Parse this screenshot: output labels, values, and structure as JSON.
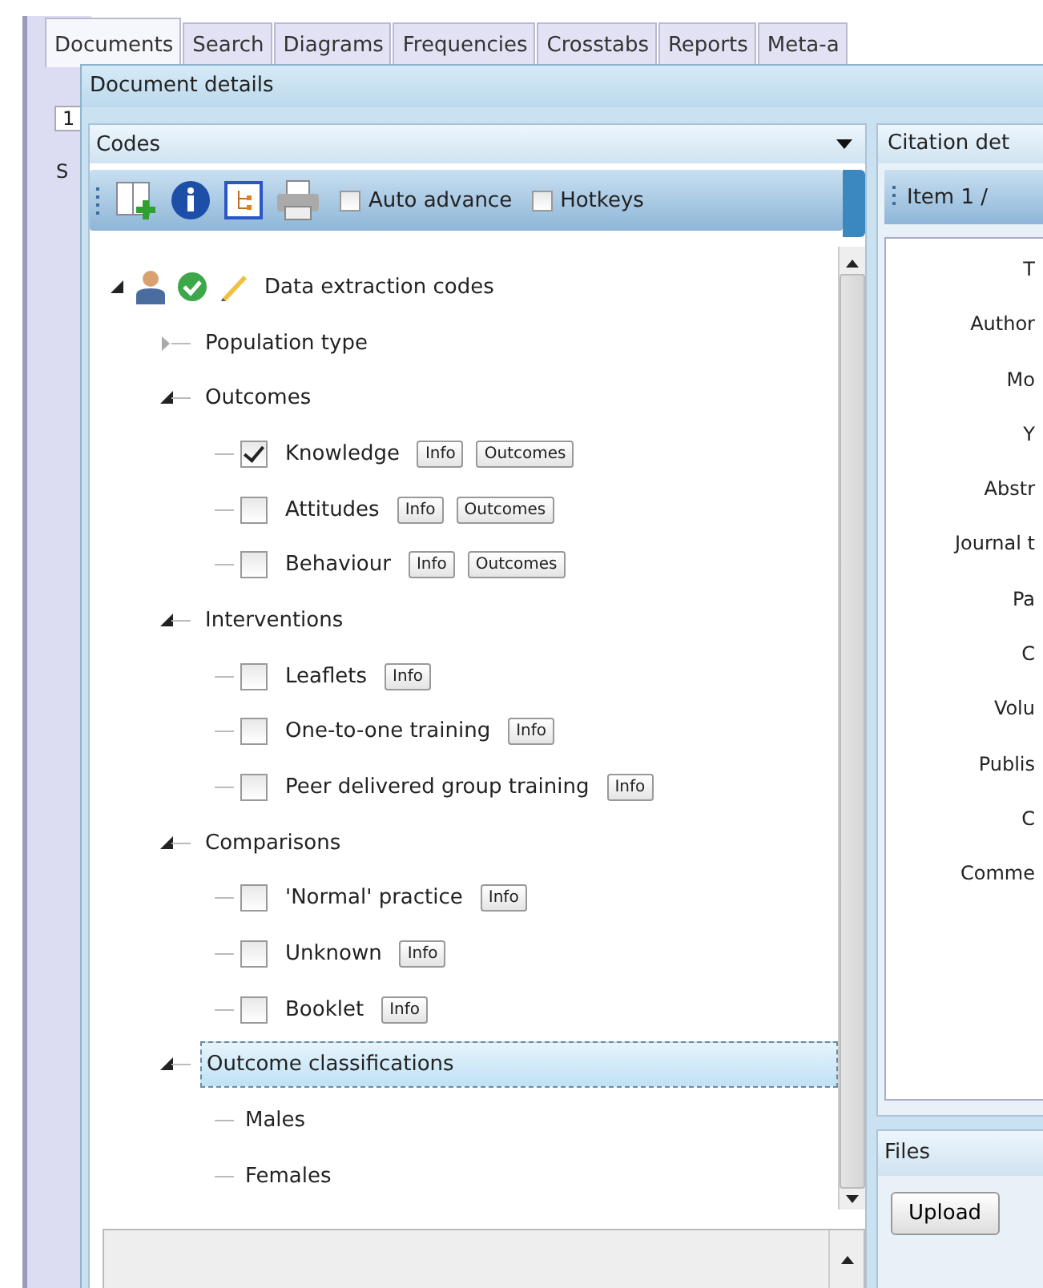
{
  "tabs": [
    {
      "label": "Documents",
      "selected": true
    },
    {
      "label": "Search",
      "selected": false
    },
    {
      "label": "Diagrams",
      "selected": false
    },
    {
      "label": "Frequencies",
      "selected": false
    },
    {
      "label": "Crosstabs",
      "selected": false
    },
    {
      "label": "Reports",
      "selected": false
    },
    {
      "label": "Meta-a",
      "selected": false
    }
  ],
  "background_panel": {
    "tab_label": "1",
    "header_label": "S"
  },
  "dialog": {
    "title": "Document details"
  },
  "codes_panel": {
    "title": "Codes",
    "toolbar": {
      "auto_advance": {
        "label": "Auto advance",
        "checked": false
      },
      "hotkeys": {
        "label": "Hotkeys",
        "checked": false
      }
    },
    "tree": {
      "label": "Data extraction codes",
      "expanded": true,
      "selected": false,
      "children": [
        {
          "label": "Population type",
          "expanded": false,
          "selected": false
        },
        {
          "label": "Outcomes",
          "expanded": true,
          "selected": false,
          "children": [
            {
              "label": "Knowledge",
              "kind": "checkbox",
              "checked": true,
              "selected": false,
              "buttons": [
                "Info",
                "Outcomes"
              ]
            },
            {
              "label": "Attitudes",
              "kind": "checkbox",
              "checked": false,
              "selected": false,
              "buttons": [
                "Info",
                "Outcomes"
              ]
            },
            {
              "label": "Behaviour",
              "kind": "checkbox",
              "checked": false,
              "selected": false,
              "buttons": [
                "Info",
                "Outcomes"
              ]
            }
          ]
        },
        {
          "label": "Interventions",
          "expanded": true,
          "selected": false,
          "children": [
            {
              "label": "Leaflets",
              "kind": "checkbox",
              "checked": false,
              "selected": false,
              "buttons": [
                "Info"
              ]
            },
            {
              "label": "One-to-one training",
              "kind": "checkbox",
              "checked": false,
              "selected": false,
              "buttons": [
                "Info"
              ]
            },
            {
              "label": "Peer delivered group training",
              "kind": "checkbox",
              "checked": false,
              "selected": false,
              "buttons": [
                "Info"
              ]
            }
          ]
        },
        {
          "label": "Comparisons",
          "expanded": true,
          "selected": false,
          "children": [
            {
              "label": "'Normal' practice",
              "kind": "checkbox",
              "checked": false,
              "selected": false,
              "buttons": [
                "Info"
              ]
            },
            {
              "label": "Unknown",
              "kind": "checkbox",
              "checked": false,
              "selected": false,
              "buttons": [
                "Info"
              ]
            },
            {
              "label": "Booklet",
              "kind": "checkbox",
              "checked": false,
              "selected": false,
              "buttons": [
                "Info"
              ]
            }
          ]
        },
        {
          "label": "Outcome classifications",
          "expanded": true,
          "selected": true,
          "children": [
            {
              "label": "Males",
              "kind": "plain",
              "selected": false
            },
            {
              "label": "Females",
              "kind": "plain",
              "selected": false
            }
          ]
        }
      ]
    }
  },
  "citation_panel": {
    "title": "Citation det",
    "item_label": "Item 1 /",
    "fields": [
      "T",
      "Author",
      "Mo",
      "Y",
      "Abstr",
      "Journal t",
      "Pa",
      "C",
      "Volu",
      "Publis",
      "C",
      "Comme"
    ]
  },
  "files_panel": {
    "title": "Files",
    "upload_button": "Upload"
  }
}
